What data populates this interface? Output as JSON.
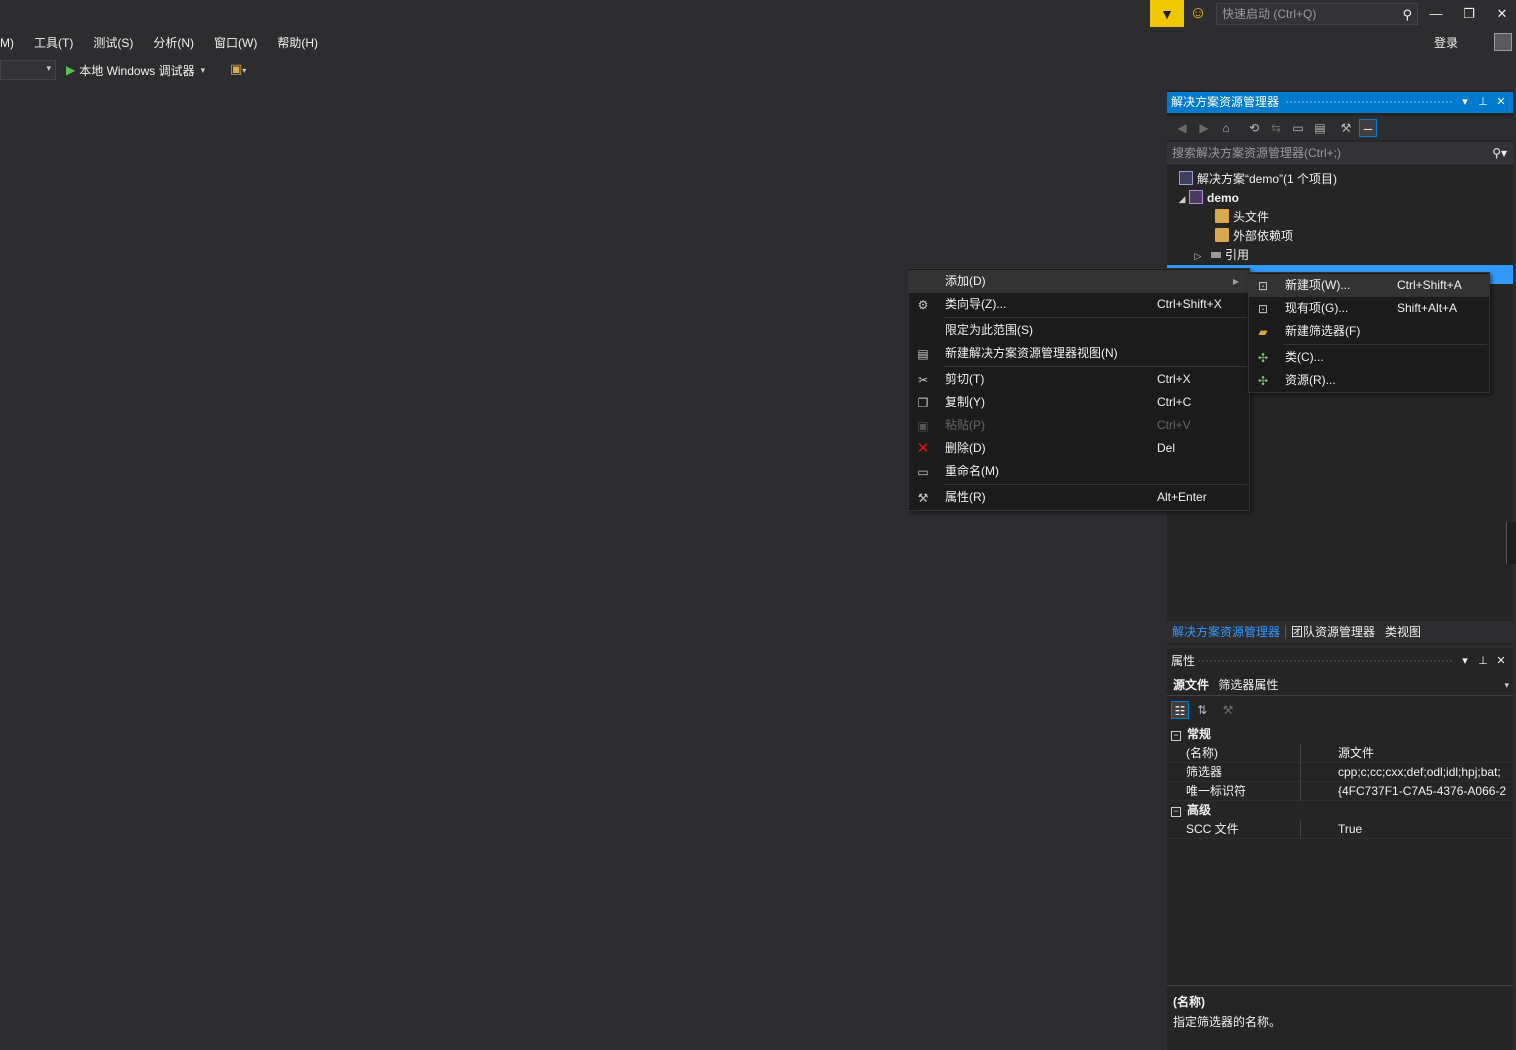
{
  "titlebar": {
    "quick_launch_placeholder": "快速启动 (Ctrl+Q)",
    "login": "登录",
    "accent": "#f0c800"
  },
  "menubar": [
    "M)",
    "工具(T)",
    "测试(S)",
    "分析(N)",
    "窗口(W)",
    "帮助(H)"
  ],
  "toolbar": {
    "debugger_label": "本地 Windows 调试器"
  },
  "solution_explorer": {
    "title": "解决方案资源管理器",
    "search_placeholder": "搜索解决方案资源管理器(Ctrl+;)",
    "tree": [
      {
        "label": "解决方案“demo”(1 个项目)",
        "icon": "solution-icon"
      },
      {
        "label": "demo",
        "icon": "project-icon"
      },
      {
        "label": "头文件",
        "icon": "folder-icon"
      },
      {
        "label": "外部依赖项",
        "icon": "folder-icon"
      },
      {
        "label": "引用",
        "icon": "references-icon"
      }
    ],
    "tabs": [
      "解决方案资源管理器",
      "团队资源管理器",
      "类视图"
    ],
    "accent": "#007acc",
    "selection": "#3399ff"
  },
  "properties": {
    "title": "属性",
    "object_name": "源文件",
    "object_type": "筛选器属性",
    "categories": [
      {
        "name": "常规",
        "rows": [
          {
            "name": "(名称)",
            "value": "源文件"
          },
          {
            "name": "筛选器",
            "value": "cpp;c;cc;cxx;def;odl;idl;hpj;bat;"
          },
          {
            "name": "唯一标识符",
            "value": "{4FC737F1-C7A5-4376-A066-2"
          }
        ]
      },
      {
        "name": "高级",
        "rows": [
          {
            "name": "SCC 文件",
            "value": "True"
          }
        ]
      }
    ],
    "desc_title": "(名称)",
    "desc_text": "指定筛选器的名称。"
  },
  "context_menu": {
    "items": [
      {
        "label": "添加(D)",
        "shortcut": "",
        "icon": "",
        "submenu": true
      },
      {
        "label": "类向导(Z)...",
        "shortcut": "Ctrl+Shift+X",
        "icon": "class-wizard-icon"
      },
      {
        "label": "限定为此范围(S)",
        "shortcut": "",
        "icon": ""
      },
      {
        "label": "新建解决方案资源管理器视图(N)",
        "shortcut": "",
        "icon": "new-view-icon"
      },
      {
        "label": "剪切(T)",
        "shortcut": "Ctrl+X",
        "icon": "scissors-icon"
      },
      {
        "label": "复制(Y)",
        "shortcut": "Ctrl+C",
        "icon": "copy-icon"
      },
      {
        "label": "粘贴(P)",
        "shortcut": "Ctrl+V",
        "icon": "paste-icon",
        "disabled": true
      },
      {
        "label": "删除(D)",
        "shortcut": "Del",
        "icon": "delete-icon"
      },
      {
        "label": "重命名(M)",
        "shortcut": "",
        "icon": "rename-icon"
      },
      {
        "label": "属性(R)",
        "shortcut": "Alt+Enter",
        "icon": "wrench-icon"
      }
    ],
    "submenu": [
      {
        "label": "新建项(W)...",
        "shortcut": "Ctrl+Shift+A",
        "icon": "new-item-icon"
      },
      {
        "label": "现有项(G)...",
        "shortcut": "Shift+Alt+A",
        "icon": "existing-item-icon"
      },
      {
        "label": "新建筛选器(F)",
        "shortcut": "",
        "icon": "new-filter-icon"
      },
      {
        "label": "类(C)...",
        "shortcut": "",
        "icon": "add-class-icon"
      },
      {
        "label": "资源(R)...",
        "shortcut": "",
        "icon": "add-resource-icon"
      }
    ],
    "delete_color": "#e51400"
  }
}
